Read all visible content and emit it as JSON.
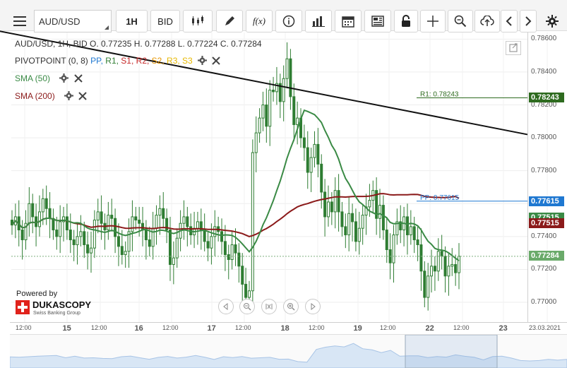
{
  "toolbar": {
    "symbol": "AUD/USD",
    "timeframe": "1H",
    "side": "BID",
    "function_label": "f(x)"
  },
  "legend": {
    "ohlc": "AUD/USD, 1H, BID   O. 0.77235 H. 0.77288 L. 0.77224 C. 0.77284",
    "pivot_prefix": "PIVOTPOINT (0, 8)",
    "pivot_items": [
      {
        "text": "PP,",
        "color": "#1f78d1"
      },
      {
        "text": "R1,",
        "color": "#2e7d32"
      },
      {
        "text": "S1,",
        "color": "#c62828"
      },
      {
        "text": "R2,",
        "color": "#c62828"
      },
      {
        "text": "S2,",
        "color": "#e69500"
      },
      {
        "text": "R3,",
        "color": "#e6b800"
      },
      {
        "text": "S3",
        "color": "#e6b800"
      }
    ],
    "sma50": "SMA (50)",
    "sma200": "SMA (200)"
  },
  "branding": {
    "powered_by": "Powered by",
    "name": "DUKASCOPY",
    "tagline": "Swiss Banking Group"
  },
  "colors": {
    "sma50": "#3a8a45",
    "sma200": "#8b1a1a",
    "candle": "#2e7d32",
    "pp": "#1f78d1",
    "r1": "#2e6b1f",
    "current": "#6aaa6a"
  },
  "chart_data": {
    "type": "candlestick",
    "instrument": "AUD/USD",
    "timeframe": "1H",
    "price_ticks": [
      "0.78600",
      "0.78400",
      "0.78200",
      "0.78000",
      "0.77800",
      "0.77600",
      "0.77400",
      "0.77200",
      "0.77000"
    ],
    "ylim": [
      0.7688,
      0.7864
    ],
    "time_ticks": [
      "12:00",
      "15",
      "12:00",
      "16",
      "12:00",
      "17",
      "12:00",
      "18",
      "12:00",
      "19",
      "12:00",
      "22",
      "12:00",
      "23",
      "23.03.2021"
    ],
    "pivot_levels": [
      {
        "label": "R1: 0.78243",
        "value": 0.78243
      },
      {
        "label": "PP: 0.77615",
        "value": 0.77615
      }
    ],
    "badges": [
      {
        "name": "R1",
        "value": "0.78243",
        "y": 0.78243
      },
      {
        "name": "PP",
        "value": "0.77615",
        "y": 0.77615
      },
      {
        "name": "SMA50",
        "value": "0.77515",
        "y": 0.77515
      },
      {
        "name": "SMA200",
        "value": "0.77515",
        "y": 0.7748
      },
      {
        "name": "Close",
        "value": "0.77284",
        "y": 0.77284
      }
    ],
    "trendline": [
      [
        0,
        0.7865
      ],
      [
        133,
        0.7802
      ]
    ],
    "closes": [
      0.7747,
      0.7752,
      0.7744,
      0.7738,
      0.7748,
      0.776,
      0.7752,
      0.7746,
      0.7755,
      0.7763,
      0.7757,
      0.7751,
      0.7744,
      0.774,
      0.7749,
      0.7752,
      0.7744,
      0.7738,
      0.7735,
      0.774,
      0.7743,
      0.7735,
      0.773,
      0.7733,
      0.775,
      0.7755,
      0.7748,
      0.7744,
      0.7753,
      0.7751,
      0.774,
      0.7734,
      0.7729,
      0.7731,
      0.7743,
      0.7752,
      0.775,
      0.7748,
      0.7744,
      0.7738,
      0.7734,
      0.7745,
      0.7753,
      0.7757,
      0.7751,
      0.7744,
      0.7723,
      0.7727,
      0.7739,
      0.7748,
      0.7752,
      0.7746,
      0.7741,
      0.7745,
      0.7749,
      0.7744,
      0.7737,
      0.7733,
      0.774,
      0.7746,
      0.7743,
      0.7737,
      0.7729,
      0.7726,
      0.7735,
      0.773,
      0.7722,
      0.7711,
      0.7703,
      0.7707,
      0.7791,
      0.7803,
      0.7812,
      0.782,
      0.7807,
      0.7829,
      0.7828,
      0.7833,
      0.7822,
      0.7836,
      0.7848,
      0.7825,
      0.7808,
      0.7812,
      0.78,
      0.7794,
      0.7779,
      0.7788,
      0.7796,
      0.7784,
      0.7767,
      0.7752,
      0.7761,
      0.7755,
      0.7768,
      0.7755,
      0.7746,
      0.7741,
      0.7754,
      0.7749,
      0.7737,
      0.7745,
      0.7753,
      0.7758,
      0.7762,
      0.7768,
      0.7751,
      0.7759,
      0.7744,
      0.7732,
      0.7724,
      0.7741,
      0.7749,
      0.7744,
      0.7752,
      0.7741,
      0.7746,
      0.7738,
      0.7735,
      0.7719,
      0.7703,
      0.7716,
      0.7722,
      0.7719,
      0.7731,
      0.7728,
      0.7716,
      0.7722,
      0.7723,
      0.7718,
      0.7728
    ]
  }
}
